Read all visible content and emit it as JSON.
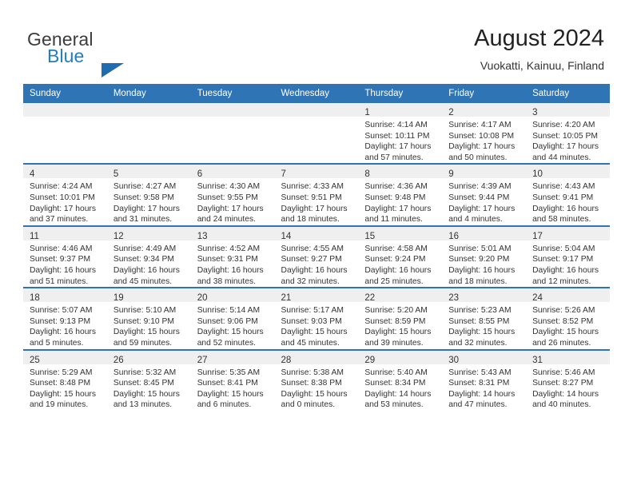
{
  "brand": {
    "word_one": "General",
    "word_two": "Blue",
    "logo_icon": "triangle-logo-icon"
  },
  "header": {
    "title": "August 2024",
    "subtitle": "Vuokatti, Kainuu, Finland"
  },
  "colors": {
    "header_blue": "#2f75b5",
    "brand_blue": "#1f7ec4",
    "daynum_band": "#efefef",
    "text": "#333333"
  },
  "calendar": {
    "weekday_headers": [
      "Sunday",
      "Monday",
      "Tuesday",
      "Wednesday",
      "Thursday",
      "Friday",
      "Saturday"
    ],
    "weeks": [
      [
        {
          "day": "",
          "lines": []
        },
        {
          "day": "",
          "lines": []
        },
        {
          "day": "",
          "lines": []
        },
        {
          "day": "",
          "lines": []
        },
        {
          "day": "1",
          "lines": [
            "Sunrise: 4:14 AM",
            "Sunset: 10:11 PM",
            "Daylight: 17 hours",
            "and 57 minutes."
          ]
        },
        {
          "day": "2",
          "lines": [
            "Sunrise: 4:17 AM",
            "Sunset: 10:08 PM",
            "Daylight: 17 hours",
            "and 50 minutes."
          ]
        },
        {
          "day": "3",
          "lines": [
            "Sunrise: 4:20 AM",
            "Sunset: 10:05 PM",
            "Daylight: 17 hours",
            "and 44 minutes."
          ]
        }
      ],
      [
        {
          "day": "4",
          "lines": [
            "Sunrise: 4:24 AM",
            "Sunset: 10:01 PM",
            "Daylight: 17 hours",
            "and 37 minutes."
          ]
        },
        {
          "day": "5",
          "lines": [
            "Sunrise: 4:27 AM",
            "Sunset: 9:58 PM",
            "Daylight: 17 hours",
            "and 31 minutes."
          ]
        },
        {
          "day": "6",
          "lines": [
            "Sunrise: 4:30 AM",
            "Sunset: 9:55 PM",
            "Daylight: 17 hours",
            "and 24 minutes."
          ]
        },
        {
          "day": "7",
          "lines": [
            "Sunrise: 4:33 AM",
            "Sunset: 9:51 PM",
            "Daylight: 17 hours",
            "and 18 minutes."
          ]
        },
        {
          "day": "8",
          "lines": [
            "Sunrise: 4:36 AM",
            "Sunset: 9:48 PM",
            "Daylight: 17 hours",
            "and 11 minutes."
          ]
        },
        {
          "day": "9",
          "lines": [
            "Sunrise: 4:39 AM",
            "Sunset: 9:44 PM",
            "Daylight: 17 hours",
            "and 4 minutes."
          ]
        },
        {
          "day": "10",
          "lines": [
            "Sunrise: 4:43 AM",
            "Sunset: 9:41 PM",
            "Daylight: 16 hours",
            "and 58 minutes."
          ]
        }
      ],
      [
        {
          "day": "11",
          "lines": [
            "Sunrise: 4:46 AM",
            "Sunset: 9:37 PM",
            "Daylight: 16 hours",
            "and 51 minutes."
          ]
        },
        {
          "day": "12",
          "lines": [
            "Sunrise: 4:49 AM",
            "Sunset: 9:34 PM",
            "Daylight: 16 hours",
            "and 45 minutes."
          ]
        },
        {
          "day": "13",
          "lines": [
            "Sunrise: 4:52 AM",
            "Sunset: 9:31 PM",
            "Daylight: 16 hours",
            "and 38 minutes."
          ]
        },
        {
          "day": "14",
          "lines": [
            "Sunrise: 4:55 AM",
            "Sunset: 9:27 PM",
            "Daylight: 16 hours",
            "and 32 minutes."
          ]
        },
        {
          "day": "15",
          "lines": [
            "Sunrise: 4:58 AM",
            "Sunset: 9:24 PM",
            "Daylight: 16 hours",
            "and 25 minutes."
          ]
        },
        {
          "day": "16",
          "lines": [
            "Sunrise: 5:01 AM",
            "Sunset: 9:20 PM",
            "Daylight: 16 hours",
            "and 18 minutes."
          ]
        },
        {
          "day": "17",
          "lines": [
            "Sunrise: 5:04 AM",
            "Sunset: 9:17 PM",
            "Daylight: 16 hours",
            "and 12 minutes."
          ]
        }
      ],
      [
        {
          "day": "18",
          "lines": [
            "Sunrise: 5:07 AM",
            "Sunset: 9:13 PM",
            "Daylight: 16 hours",
            "and 5 minutes."
          ]
        },
        {
          "day": "19",
          "lines": [
            "Sunrise: 5:10 AM",
            "Sunset: 9:10 PM",
            "Daylight: 15 hours",
            "and 59 minutes."
          ]
        },
        {
          "day": "20",
          "lines": [
            "Sunrise: 5:14 AM",
            "Sunset: 9:06 PM",
            "Daylight: 15 hours",
            "and 52 minutes."
          ]
        },
        {
          "day": "21",
          "lines": [
            "Sunrise: 5:17 AM",
            "Sunset: 9:03 PM",
            "Daylight: 15 hours",
            "and 45 minutes."
          ]
        },
        {
          "day": "22",
          "lines": [
            "Sunrise: 5:20 AM",
            "Sunset: 8:59 PM",
            "Daylight: 15 hours",
            "and 39 minutes."
          ]
        },
        {
          "day": "23",
          "lines": [
            "Sunrise: 5:23 AM",
            "Sunset: 8:55 PM",
            "Daylight: 15 hours",
            "and 32 minutes."
          ]
        },
        {
          "day": "24",
          "lines": [
            "Sunrise: 5:26 AM",
            "Sunset: 8:52 PM",
            "Daylight: 15 hours",
            "and 26 minutes."
          ]
        }
      ],
      [
        {
          "day": "25",
          "lines": [
            "Sunrise: 5:29 AM",
            "Sunset: 8:48 PM",
            "Daylight: 15 hours",
            "and 19 minutes."
          ]
        },
        {
          "day": "26",
          "lines": [
            "Sunrise: 5:32 AM",
            "Sunset: 8:45 PM",
            "Daylight: 15 hours",
            "and 13 minutes."
          ]
        },
        {
          "day": "27",
          "lines": [
            "Sunrise: 5:35 AM",
            "Sunset: 8:41 PM",
            "Daylight: 15 hours",
            "and 6 minutes."
          ]
        },
        {
          "day": "28",
          "lines": [
            "Sunrise: 5:38 AM",
            "Sunset: 8:38 PM",
            "Daylight: 15 hours",
            "and 0 minutes."
          ]
        },
        {
          "day": "29",
          "lines": [
            "Sunrise: 5:40 AM",
            "Sunset: 8:34 PM",
            "Daylight: 14 hours",
            "and 53 minutes."
          ]
        },
        {
          "day": "30",
          "lines": [
            "Sunrise: 5:43 AM",
            "Sunset: 8:31 PM",
            "Daylight: 14 hours",
            "and 47 minutes."
          ]
        },
        {
          "day": "31",
          "lines": [
            "Sunrise: 5:46 AM",
            "Sunset: 8:27 PM",
            "Daylight: 14 hours",
            "and 40 minutes."
          ]
        }
      ]
    ]
  }
}
